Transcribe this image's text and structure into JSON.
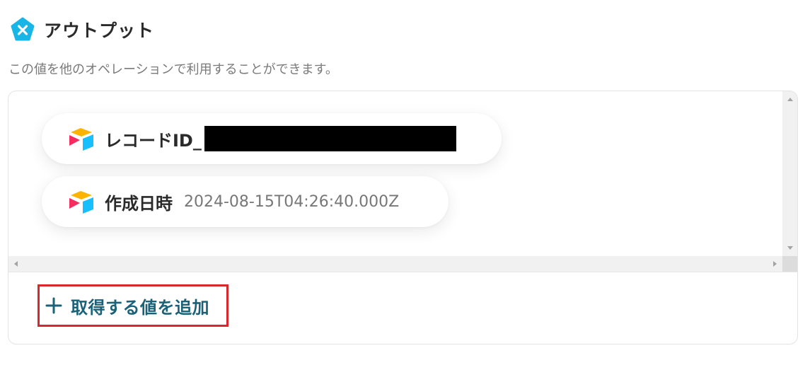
{
  "section": {
    "title": "アウトプット",
    "icon": "yoom-logo-icon",
    "description": "この値を他のオペレーションで利用することができます。"
  },
  "outputs": [
    {
      "label": "レコードID_",
      "value": "",
      "value_redacted": true,
      "icon": "airtable-icon"
    },
    {
      "label": "作成日時",
      "value": "2024-08-15T04:26:40.000Z",
      "value_redacted": false,
      "icon": "airtable-icon"
    }
  ],
  "add_value": {
    "label": "取得する値を追加",
    "icon": "plus-icon"
  },
  "colors": {
    "accent": "#1b6278",
    "highlight_border": "#d9272e",
    "logo": "#18b6e6",
    "airtable_yellow": "#fcb400",
    "airtable_blue": "#2d7ff9",
    "airtable_cyan": "#18bfff",
    "airtable_red": "#f82b60"
  }
}
